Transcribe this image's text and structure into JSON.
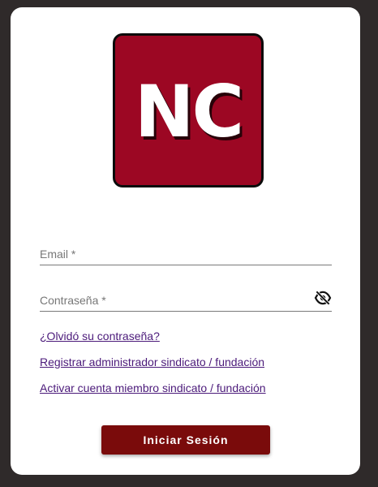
{
  "logo": {
    "text": "NC",
    "background": "#9c0723"
  },
  "form": {
    "email_label": "Email *",
    "email_value": "",
    "password_label": "Contraseña *",
    "password_value": "",
    "password_toggle_icon": "eye-off-icon"
  },
  "links": {
    "forgot_password": "¿Olvidó su contraseña?",
    "register_admin": "Registrar administrador sindicato / fundación",
    "activate_member": "Activar cuenta miembro sindicato / fundación"
  },
  "actions": {
    "login_label": "Iniciar Sesión"
  },
  "colors": {
    "page_background": "#2f2a2a",
    "card_background": "#ffffff",
    "link": "#4b1a7a",
    "primary_button": "#7a0b0b"
  }
}
